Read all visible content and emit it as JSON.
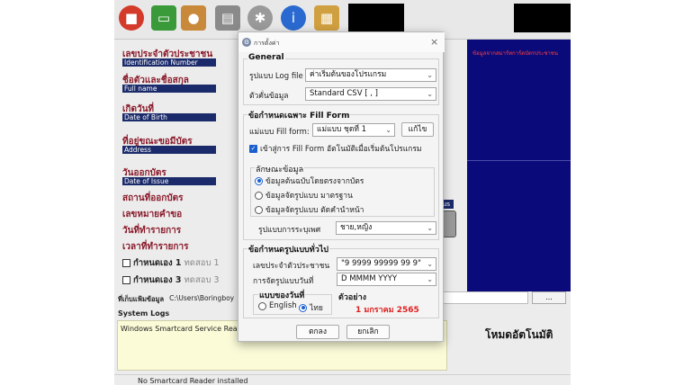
{
  "colors": {
    "accent": "#1a5fd0",
    "field_label": "#8a1a2a",
    "photo_panel": "#0a0a7a",
    "sample_red": "#e02020"
  },
  "toolbar": {
    "icons": [
      "stop-icon",
      "card-icon",
      "user-icon",
      "printer-icon",
      "gear-icon",
      "info-icon",
      "clipboard-icon"
    ]
  },
  "fields": [
    {
      "th": "เลขประจำตัวประชาชน",
      "en": "Identification Number"
    },
    {
      "th": "ชื่อตัวและชื่อสกุล",
      "en": "Full name"
    },
    {
      "th": "เกิดวันที่",
      "en": "Date of Birth"
    },
    {
      "th": "ที่อยู่ขณะขอมีบัตร",
      "en": "Address"
    },
    {
      "th": "วันออกบัตร",
      "en": "Date of Issue"
    }
  ],
  "extra_fields": [
    "สถานที่ออกบัตร",
    "เลขหมายคำขอ",
    "วันที่ทำรายการ",
    "เวลาที่ทำรายการ"
  ],
  "custom_checks": [
    {
      "label": "กำหนดเอง 1",
      "sub": "ทดสอบ 1"
    },
    {
      "label": "กำหนดเอง 3",
      "sub": "ทดสอบ 3"
    }
  ],
  "photo_panel": {
    "header": "ข้อมูลจากสมาร์ทการ์ดบัตรประชาชน"
  },
  "us_label": "us",
  "folder": {
    "label": "ที่เก็บแฟ้มข้อมูล",
    "path": "C:\\Users\\Boringboy"
  },
  "browse_label": "...",
  "logs": {
    "title": "System Logs",
    "text": "Windows Smartcard Service Ready."
  },
  "mode_label": "โหมดอัตโนมัติ",
  "status_text": "No Smartcard Reader installed",
  "dialog": {
    "title": "การตั้งค่า",
    "close": "×",
    "general": {
      "title": "General",
      "log_label": "รูปแบบ Log file",
      "log_value": "ค่าเริ่มต้นของโปรแกรม",
      "sep_label": "ตัวคั่นข้อมูล",
      "sep_value": "Standard CSV [ , ]"
    },
    "fillform": {
      "title": "ข้อกำหนดเฉพาะ Fill Form",
      "template_label": "แม่แบบ Fill form:",
      "template_value": "แม่แบบ ชุดที่ 1",
      "edit_button": "แก้ไข",
      "auto_check": "เข้าสู่การ Fill Form อัตโนมัติเมื่อเริ่มต้นโปรแกรม",
      "data_group": "ลักษณะข้อมูล",
      "options": [
        "ข้อมูลต้นฉบับโดยตรงจากบัตร",
        "ข้อมูลจัดรูปแบบ มาตรฐาน",
        "ข้อมูลจัดรูปแบบ ตัดคำนำหน้า"
      ],
      "selected_option": 0,
      "gender_label": "รูปแบบการระบุเพศ",
      "gender_value": "ชาย,หญิง"
    },
    "general_format": {
      "title": "ข้อกำหนดรูปแบบทั่วไป",
      "id_label": "เลขประจำตัวประชาชน",
      "id_value": "\"9 9999 99999 99 9\"",
      "date_label": "การจัดรูปแบบวันที่",
      "date_value": "D MMMM YYYY",
      "lang_group": "แบบของวันที่",
      "lang_options": [
        "English",
        "ไทย"
      ],
      "selected_lang": 1,
      "sample_label": "ตัวอย่าง",
      "sample_value": "1 มกราคม 2565"
    },
    "ok": "ตกลง",
    "cancel": "ยกเลิก"
  }
}
